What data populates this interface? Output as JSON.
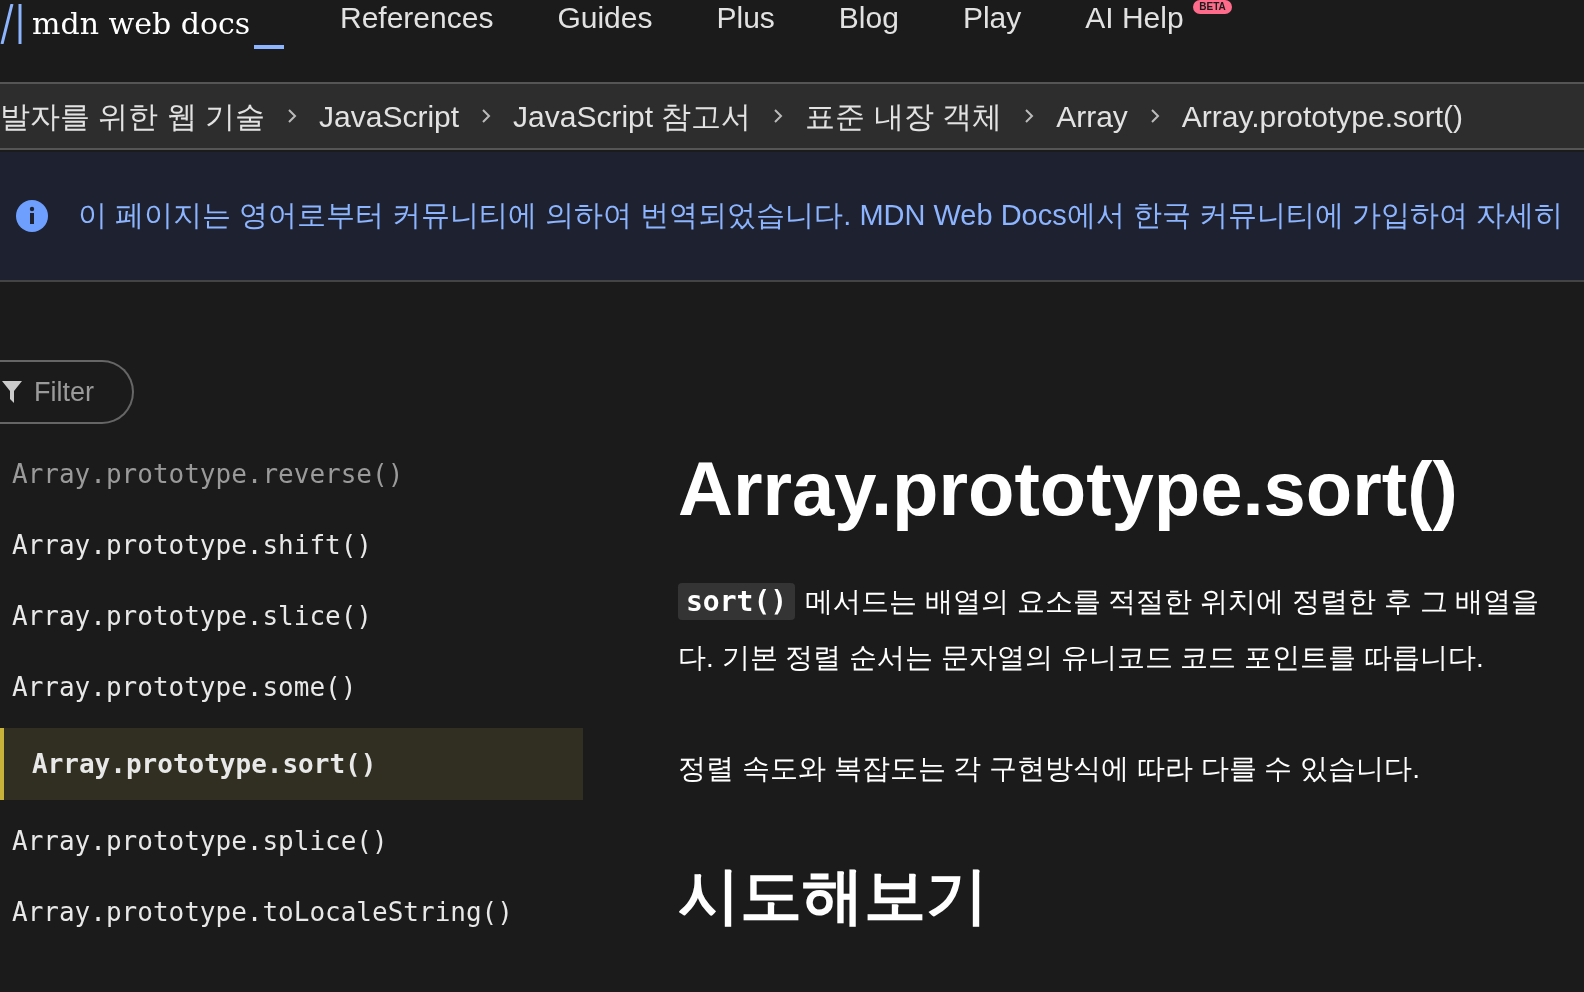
{
  "header": {
    "logo": "mdn web docs",
    "nav": [
      {
        "label": "References"
      },
      {
        "label": "Guides"
      },
      {
        "label": "Plus"
      },
      {
        "label": "Blog"
      },
      {
        "label": "Play"
      },
      {
        "label": "AI Help",
        "badge": "BETA"
      }
    ]
  },
  "breadcrumbs": [
    "발자를 위한 웹 기술",
    "JavaScript",
    "JavaScript 참고서",
    "표준 내장 객체",
    "Array",
    "Array.prototype.sort()"
  ],
  "banner": {
    "text": "이 페이지는 영어로부터 커뮤니티에 의하여 번역되었습니다. MDN Web Docs에서 한국 커뮤니티에 가입하여 자세히"
  },
  "sidebar": {
    "filter": {
      "placeholder": "Filter"
    },
    "items": [
      {
        "label": "Array.prototype.reverse()",
        "selected": false,
        "dimmed": true
      },
      {
        "label": "Array.prototype.shift()",
        "selected": false,
        "dimmed": false
      },
      {
        "label": "Array.prototype.slice()",
        "selected": false,
        "dimmed": false
      },
      {
        "label": "Array.prototype.some()",
        "selected": false,
        "dimmed": false
      },
      {
        "label": "Array.prototype.sort()",
        "selected": true,
        "dimmed": false
      },
      {
        "label": "Array.prototype.splice()",
        "selected": false,
        "dimmed": false
      },
      {
        "label": "Array.prototype.toLocaleString()",
        "selected": false,
        "dimmed": false
      }
    ]
  },
  "article": {
    "title": "Array.prototype.sort()",
    "intro_code": "sort()",
    "intro_lines": [
      "메서드는 배열의 요소를 적절한 위치에 정렬한 후 그 배열을",
      "다. 기본 정렬 순서는 문자열의 유니코드 코드 포인트를 따릅니다."
    ],
    "note": "정렬 속도와 복잡도는 각 구현방식에 따라 다를 수 있습니다.",
    "heading": "시도해보기"
  }
}
